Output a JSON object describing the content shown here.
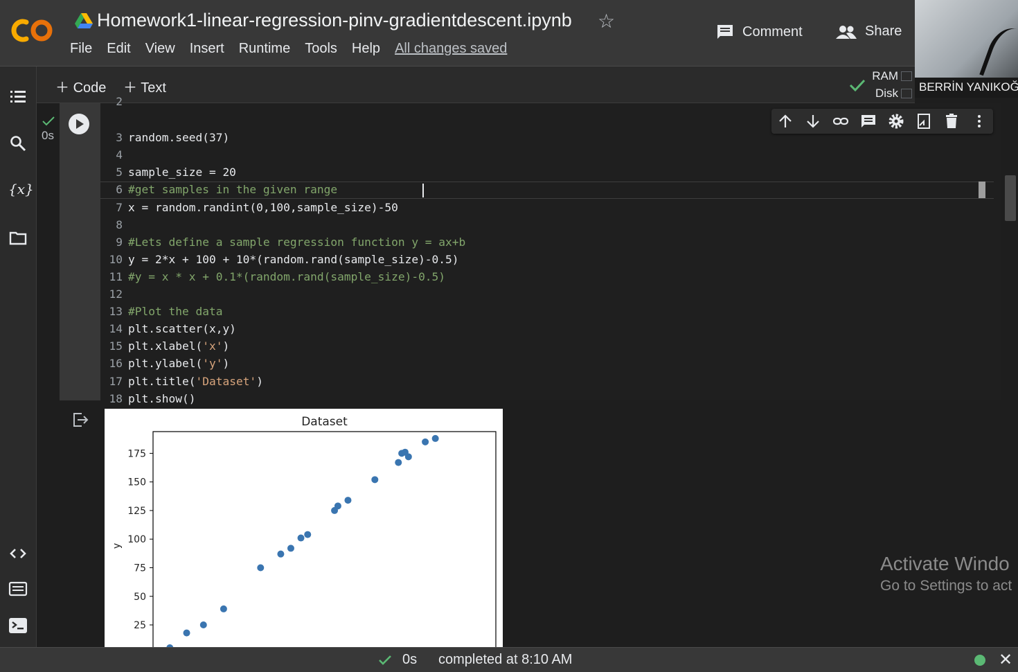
{
  "header": {
    "title": "Homework1-linear-regression-pinv-gradientdescent.ipynb",
    "menu": [
      "File",
      "Edit",
      "View",
      "Insert",
      "Runtime",
      "Tools",
      "Help"
    ],
    "saved_status": "All changes saved",
    "comment_label": "Comment",
    "share_label": "Share"
  },
  "webcam": {
    "name": "BERRİN YANIKOĞ"
  },
  "toolbar": {
    "code_label": "Code",
    "text_label": "Text"
  },
  "resources": {
    "ram_label": "RAM",
    "disk_label": "Disk"
  },
  "cell": {
    "exec_time": "0s",
    "lines": [
      {
        "n": "2",
        "t": ""
      },
      {
        "n": "3",
        "t": "random.seed(37)"
      },
      {
        "n": "4",
        "t": ""
      },
      {
        "n": "5",
        "t": "sample_size = 20"
      },
      {
        "n": "6",
        "t": "#get samples in the given range"
      },
      {
        "n": "7",
        "t": "x = random.randint(0,100,sample_size)-50"
      },
      {
        "n": "8",
        "t": ""
      },
      {
        "n": "9",
        "t": "#Lets define a sample regression function y = ax+b"
      },
      {
        "n": "10",
        "t": "y = 2*x + 100 + 10*(random.rand(sample_size)-0.5)"
      },
      {
        "n": "11",
        "t": "#y = x * x + 0.1*(random.rand(sample_size)-0.5)"
      },
      {
        "n": "12",
        "t": ""
      },
      {
        "n": "13",
        "t": "#Plot the data"
      },
      {
        "n": "14",
        "t": "plt.scatter(x,y)"
      },
      {
        "n": "15",
        "t": "plt.xlabel('x')"
      },
      {
        "n": "16",
        "t": "plt.ylabel('y')"
      },
      {
        "n": "17",
        "t": "plt.title('Dataset')"
      },
      {
        "n": "18",
        "t": "plt.show()"
      }
    ]
  },
  "chart_data": {
    "type": "scatter",
    "title": "Dataset",
    "ylabel": "y",
    "xlabel": "",
    "yticks": [
      25,
      50,
      75,
      100,
      125,
      150,
      175
    ],
    "ylim": [
      2,
      194
    ],
    "xlim": [
      -52,
      50
    ],
    "series": [
      {
        "x": [
          -47,
          -42,
          -37,
          -31,
          -20,
          -14,
          -11,
          -8,
          -6,
          2,
          3,
          6,
          14,
          21,
          22,
          23,
          24,
          29,
          32
        ],
        "y": [
          5,
          18,
          25,
          39,
          75,
          87,
          92,
          101,
          104,
          125,
          129,
          134,
          152,
          167,
          175,
          176,
          172,
          185,
          188
        ]
      }
    ],
    "grid": false,
    "color": "#3a75b0"
  },
  "watermark": {
    "line1": "Activate Windo",
    "line2": "Go to Settings to act"
  },
  "status": {
    "time": "0s",
    "completed": "completed at 8:10 AM"
  }
}
